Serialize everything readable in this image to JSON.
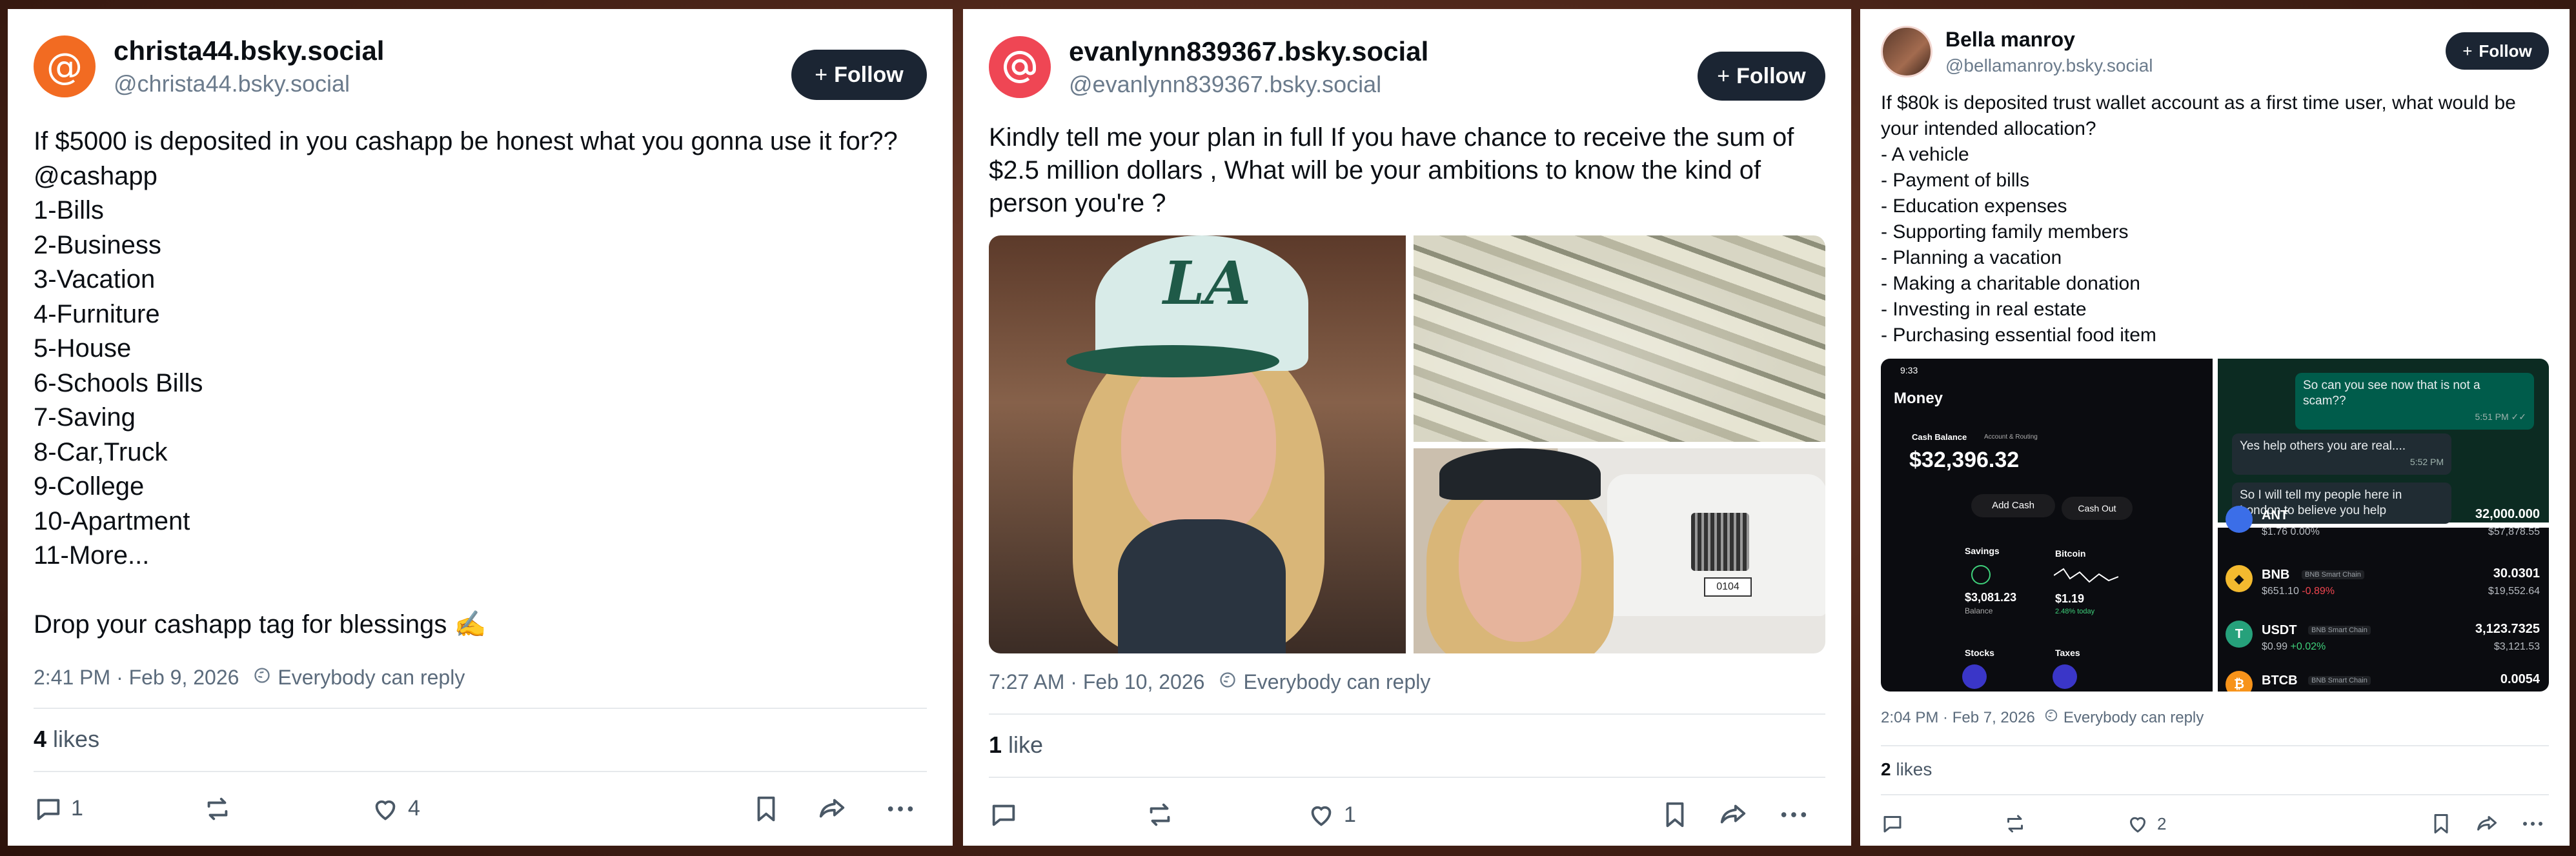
{
  "posts": [
    {
      "display_name": "christa44.bsky.social",
      "handle": "@christa44.bsky.social",
      "avatar_glyph": "@",
      "follow_label": "Follow",
      "text": "If $5000 is deposited in you cashapp be honest what you gonna use it for??@cashapp\n1-Bills\n2-Business\n3-Vacation\n4-Furniture\n5-House\n6-Schools Bills\n7-Saving\n8-Car,Truck\n9-College\n10-Apartment\n11-More...\n\nDrop your cashapp tag for blessings ✍️",
      "timestamp": "2:41 PM · Feb 9, 2026",
      "reply_setting": "Everybody can reply",
      "likes_count": "4",
      "likes_label": "likes",
      "reply_count": "1",
      "repost_count": "",
      "like_count": "4"
    },
    {
      "display_name": "evanlynn839367.bsky.social",
      "handle": "@evanlynn839367.bsky.social",
      "avatar_glyph": "@",
      "follow_label": "Follow",
      "text": "Kindly tell me your plan in full If you have chance to receive the sum of $2.5 million dollars , What will be your ambitions  to know the kind of person you're ?",
      "timestamp": "7:27 AM · Feb 10, 2026",
      "reply_setting": "Everybody can reply",
      "likes_count": "1",
      "likes_label": "like",
      "reply_count": "",
      "repost_count": "",
      "like_count": "1",
      "media": {
        "cap_logo": "LA",
        "plate": "0104"
      }
    },
    {
      "display_name": "Bella manroy",
      "handle": "@bellamanroy.bsky.social",
      "follow_label": "Follow",
      "text": "If $80k is deposited  trust wallet account as a first time user, what would be your intended allocation?\n- A vehicle\n- Payment of bills\n- Education expenses\n- Supporting family members\n- Planning a vacation\n- Making a charitable donation\n- Investing in real estate\n- Purchasing essential food item",
      "timestamp": "2:04 PM · Feb 7, 2026",
      "reply_setting": "Everybody can reply",
      "likes_count": "2",
      "likes_label": "likes",
      "reply_count": "",
      "repost_count": "",
      "like_count": "2",
      "media": {
        "phone": {
          "time": "9:33",
          "title": "Money",
          "cash_balance_label": "Cash Balance",
          "routing_label": "Account & Routing",
          "balance": "$32,396.32",
          "add_cash": "Add Cash",
          "cash_out": "Cash Out",
          "savings_label": "Savings",
          "savings_value": "$3,081.23",
          "savings_sub": "Balance",
          "bitcoin_label": "Bitcoin",
          "bitcoin_value": "$1.19",
          "bitcoin_sub": "2.48% today",
          "stocks_label": "Stocks",
          "taxes_label": "Taxes"
        },
        "chat": [
          {
            "from": "me",
            "text": "So can you see now that is not a scam??",
            "time": "5:51 PM ✓✓"
          },
          {
            "from": "them",
            "text": "Yes help others you are real....",
            "time": "5:52 PM"
          },
          {
            "from": "them",
            "text": "So I will tell my people here in London to believe you help",
            "time": ""
          }
        ],
        "crypto": [
          {
            "symbol": "ANT",
            "chain": "",
            "price": "$1.76",
            "change": "0.00%",
            "change_color": "#b8bcc2",
            "amount": "32,000.000",
            "value": "$57,878.55",
            "coin_color": "#3b6ee8"
          },
          {
            "symbol": "BNB",
            "chain": "BNB Smart Chain",
            "price": "$651.10",
            "change": "-0.89%",
            "change_color": "#f0454f",
            "amount": "30.0301",
            "value": "$19,552.64",
            "coin_color": "#f3ba2f"
          },
          {
            "symbol": "USDT",
            "chain": "BNB Smart Chain",
            "price": "$0.99",
            "change": "+0.02%",
            "change_color": "#3ed07a",
            "amount": "3,123.7325",
            "value": "$3,121.53",
            "coin_color": "#26a17b"
          },
          {
            "symbol": "BTCB",
            "chain": "BNB Smart Chain",
            "price": "",
            "change": "",
            "change_color": "#b8bcc2",
            "amount": "0.0054",
            "value": "",
            "coin_color": "#f7931a"
          }
        ]
      }
    }
  ],
  "icons": {
    "reply": "speech-bubble-icon",
    "repost": "repost-arrows-icon",
    "like": "heart-icon",
    "bookmark": "bookmark-icon",
    "share": "share-arrow-icon",
    "more": "more-dots-icon",
    "reply_setting": "globe-reply-icon"
  },
  "colors": {
    "follow_button": "#1b2533",
    "avatar_orange": "#f26b22",
    "avatar_red": "#ef4654",
    "muted_text": "#5b6b7c"
  }
}
